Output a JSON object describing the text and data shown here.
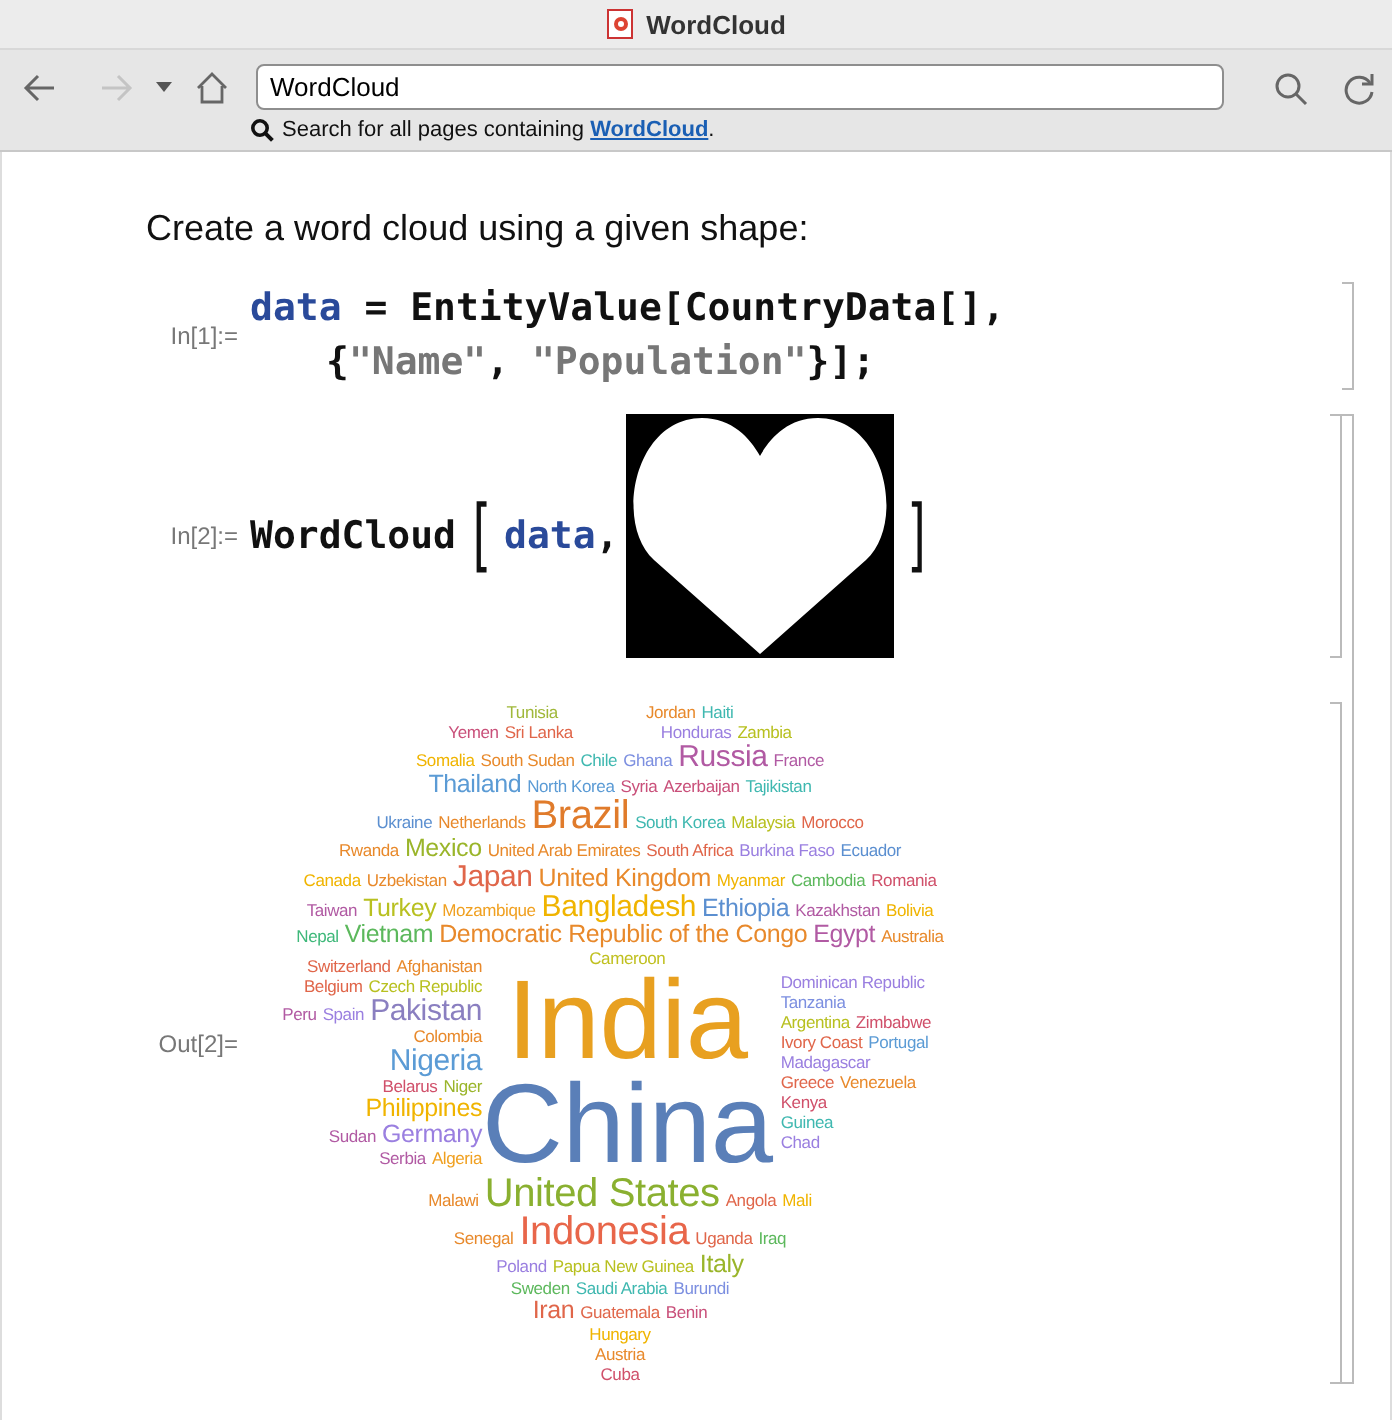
{
  "window": {
    "title": "WordCloud"
  },
  "toolbar": {
    "buttons": [
      {
        "kind": "back",
        "disabled": false
      },
      {
        "kind": "forward",
        "disabled": true
      },
      {
        "kind": "history",
        "disabled": false
      },
      {
        "kind": "home",
        "disabled": false
      }
    ],
    "address": "WordCloud",
    "actions": [
      {
        "kind": "search"
      },
      {
        "kind": "reload"
      }
    ],
    "hint": {
      "text": "Search for all pages containing ",
      "link": "WordCloud",
      "end": "."
    }
  },
  "notebook": {
    "heading": "Create a word cloud using a given shape:",
    "groups": [
      {
        "cells": [
          {
            "kind": "input",
            "label": "In[1]:=",
            "lines": [
              [
                {
                  "kind": "variable",
                  "text": "data"
                },
                {
                  "kind": "plain",
                  "text": " = EntityValue[CountryData[],"
                }
              ],
              [
                {
                  "kind": "plain",
                  "text": "{"
                },
                {
                  "kind": "string",
                  "text": "\"Name\""
                },
                {
                  "kind": "plain",
                  "text": ", "
                },
                {
                  "kind": "string",
                  "text": "\"Population\""
                },
                {
                  "kind": "plain",
                  "text": "}];"
                }
              ]
            ]
          }
        ]
      },
      {
        "cells": [
          {
            "kind": "input",
            "label": "In[2]:=",
            "lines": [
              [
                {
                  "kind": "plain",
                  "text": "WordCloud"
                },
                {
                  "kind": "bracket",
                  "text": "["
                },
                {
                  "kind": "variable",
                  "text": "data"
                },
                {
                  "kind": "plain",
                  "text": ","
                },
                {
                  "kind": "image"
                },
                {
                  "kind": "bracket",
                  "text": "]"
                }
              ]
            ]
          },
          {
            "kind": "output",
            "label": "Out[2]=",
            "cloud": {
              "top": [
                [
                  [
                    {
                      "text": "Tunisia",
                      "kind": "sm",
                      "color": "#a0b83a"
                    }
                  ],
                  [
                    {
                      "text": "Jordan",
                      "kind": "sm",
                      "color": "#e8892b"
                    },
                    {
                      "text": "Haiti",
                      "kind": "sm",
                      "color": "#3fb8b0"
                    }
                  ]
                ],
                [
                  [
                    {
                      "text": "Yemen",
                      "kind": "sm",
                      "color": "#c9507a"
                    },
                    {
                      "text": "Sri Lanka",
                      "kind": "sm",
                      "color": "#e0664a"
                    }
                  ],
                  [
                    {
                      "text": "Honduras",
                      "kind": "sm",
                      "color": "#9a7fe0"
                    },
                    {
                      "text": "Zambia",
                      "kind": "sm",
                      "color": "#b8c020"
                    }
                  ]
                ],
                [
                  [
                    {
                      "text": "Somalia",
                      "kind": "sm",
                      "color": "#f0b400"
                    },
                    {
                      "text": "South Sudan",
                      "kind": "sm",
                      "color": "#e8892b"
                    },
                    {
                      "text": "Chile",
                      "kind": "sm",
                      "color": "#3fb8b0"
                    },
                    {
                      "text": "Ghana",
                      "kind": "sm",
                      "color": "#7c8fe0"
                    },
                    {
                      "text": "Russia",
                      "kind": "ml",
                      "color": "#b15aa3"
                    },
                    {
                      "text": "France",
                      "kind": "sm",
                      "color": "#b15aa3"
                    }
                  ]
                ],
                [
                  [
                    {
                      "text": "Thailand",
                      "kind": "md",
                      "color": "#5b9bd5"
                    },
                    {
                      "text": "North Korea",
                      "kind": "sm",
                      "color": "#5b9bd5"
                    },
                    {
                      "text": "Syria",
                      "kind": "sm",
                      "color": "#c9507a"
                    },
                    {
                      "text": "Azerbaijan",
                      "kind": "sm",
                      "color": "#c9507a"
                    },
                    {
                      "text": "Tajikistan",
                      "kind": "sm",
                      "color": "#3fb8b0"
                    }
                  ]
                ],
                [
                  [
                    {
                      "text": "Ukraine",
                      "kind": "sm",
                      "color": "#5b8fd0"
                    },
                    {
                      "text": "Netherlands",
                      "kind": "sm",
                      "color": "#e8892b"
                    },
                    {
                      "text": "Brazil",
                      "kind": "lg",
                      "color": "#e07b2b"
                    },
                    {
                      "text": "South Korea",
                      "kind": "sm",
                      "color": "#3fb8b0"
                    },
                    {
                      "text": "Malaysia",
                      "kind": "sm",
                      "color": "#b8c020"
                    },
                    {
                      "text": "Morocco",
                      "kind": "sm",
                      "color": "#e0664a"
                    }
                  ]
                ],
                [
                  [
                    {
                      "text": "Rwanda",
                      "kind": "sm",
                      "color": "#e8892b"
                    },
                    {
                      "text": "Mexico",
                      "kind": "md",
                      "color": "#9ab52a"
                    },
                    {
                      "text": "United Arab Emirates",
                      "kind": "sm",
                      "color": "#e8892b"
                    },
                    {
                      "text": "South Africa",
                      "kind": "sm",
                      "color": "#e0664a"
                    },
                    {
                      "text": "Burkina Faso",
                      "kind": "sm",
                      "color": "#9a7fe0"
                    },
                    {
                      "text": "Ecuador",
                      "kind": "sm",
                      "color": "#5b8fd0"
                    }
                  ]
                ],
                [
                  [
                    {
                      "text": "Canada",
                      "kind": "sm",
                      "color": "#f0b400"
                    },
                    {
                      "text": "Uzbekistan",
                      "kind": "sm",
                      "color": "#e8892b"
                    },
                    {
                      "text": "Japan",
                      "kind": "ml",
                      "color": "#e0664a"
                    },
                    {
                      "text": "United Kingdom",
                      "kind": "md",
                      "color": "#e8892b"
                    },
                    {
                      "text": "Myanmar",
                      "kind": "sm",
                      "color": "#f0b400"
                    },
                    {
                      "text": "Cambodia",
                      "kind": "sm",
                      "color": "#5cb85c"
                    },
                    {
                      "text": "Romania",
                      "kind": "sm",
                      "color": "#d0506a"
                    }
                  ]
                ],
                [
                  [
                    {
                      "text": "Taiwan",
                      "kind": "sm",
                      "color": "#b15aa3"
                    },
                    {
                      "text": "Turkey",
                      "kind": "md",
                      "color": "#b8c020"
                    },
                    {
                      "text": "Mozambique",
                      "kind": "sm",
                      "color": "#f0a020"
                    },
                    {
                      "text": "Bangladesh",
                      "kind": "ml",
                      "color": "#f0b400"
                    },
                    {
                      "text": "Ethiopia",
                      "kind": "md",
                      "color": "#5b8fd0"
                    },
                    {
                      "text": "Kazakhstan",
                      "kind": "sm",
                      "color": "#b15aa3"
                    },
                    {
                      "text": "Bolivia",
                      "kind": "sm",
                      "color": "#f0b400"
                    }
                  ]
                ],
                [
                  [
                    {
                      "text": "Nepal",
                      "kind": "sm",
                      "color": "#3fb87a"
                    },
                    {
                      "text": "Vietnam",
                      "kind": "md",
                      "color": "#5cb85c"
                    },
                    {
                      "text": "Democratic Republic of the Congo",
                      "kind": "md",
                      "color": "#e8892b"
                    },
                    {
                      "text": "Egypt",
                      "kind": "md",
                      "color": "#b15aa3"
                    },
                    {
                      "text": "Australia",
                      "kind": "sm",
                      "color": "#e8892b"
                    }
                  ]
                ]
              ],
              "left": [
                [
                  [
                    {
                      "text": "Switzerland",
                      "kind": "sm",
                      "color": "#e0664a"
                    },
                    {
                      "text": "Afghanistan",
                      "kind": "sm",
                      "color": "#e8892b"
                    }
                  ]
                ],
                [
                  [
                    {
                      "text": "Belgium",
                      "kind": "sm",
                      "color": "#e0664a"
                    },
                    {
                      "text": "Czech Republic",
                      "kind": "sm",
                      "color": "#b8c020"
                    }
                  ]
                ],
                [
                  [
                    {
                      "text": "Peru",
                      "kind": "sm",
                      "color": "#b15aa3"
                    },
                    {
                      "text": "Spain",
                      "kind": "sm",
                      "color": "#9a7fe0"
                    },
                    {
                      "text": "Pakistan",
                      "kind": "ml",
                      "color": "#8a7fc0"
                    }
                  ]
                ],
                [
                  [
                    {
                      "text": "Colombia",
                      "kind": "sm",
                      "color": "#e8892b"
                    }
                  ]
                ],
                [
                  [
                    {
                      "text": "Nigeria",
                      "kind": "ml",
                      "color": "#5b9bd5"
                    }
                  ]
                ],
                [
                  [
                    {
                      "text": "Belarus",
                      "kind": "sm",
                      "color": "#d0506a"
                    },
                    {
                      "text": "Niger",
                      "kind": "sm",
                      "color": "#9ab52a"
                    }
                  ]
                ],
                [
                  [
                    {
                      "text": "Philippines",
                      "kind": "md",
                      "color": "#f0b400"
                    }
                  ]
                ],
                [
                  [
                    {
                      "text": "Sudan",
                      "kind": "sm",
                      "color": "#b15aa3"
                    },
                    {
                      "text": "Germany",
                      "kind": "md",
                      "color": "#9a7fe0"
                    }
                  ]
                ],
                [
                  [
                    {
                      "text": "Serbia",
                      "kind": "sm",
                      "color": "#b15aa3"
                    },
                    {
                      "text": "Algeria",
                      "kind": "sm",
                      "color": "#f0a020"
                    }
                  ]
                ]
              ],
              "center": [
                [
                  [
                    {
                      "text": "Cameroon",
                      "kind": "sm",
                      "color": "#c0c020"
                    }
                  ]
                ],
                [
                  [
                    {
                      "text": "India",
                      "kind": "xl",
                      "color": "#e8a020"
                    }
                  ]
                ],
                [
                  [
                    {
                      "text": "China",
                      "kind": "xl",
                      "color": "#5a7fb8"
                    }
                  ]
                ]
              ],
              "right": [
                [
                  [
                    {
                      "text": "Dominican Republic",
                      "kind": "sm",
                      "color": "#9a7fe0"
                    }
                  ]
                ],
                [
                  [
                    {
                      "text": "Tanzania",
                      "kind": "sm",
                      "color": "#7c8fe0"
                    }
                  ]
                ],
                [
                  [
                    {
                      "text": "Argentina",
                      "kind": "sm",
                      "color": "#b8c020"
                    },
                    {
                      "text": "Zimbabwe",
                      "kind": "sm",
                      "color": "#d0506a"
                    }
                  ]
                ],
                [
                  [
                    {
                      "text": "Ivory Coast",
                      "kind": "sm",
                      "color": "#e0664a"
                    },
                    {
                      "text": "Portugal",
                      "kind": "sm",
                      "color": "#5b9bd5"
                    }
                  ]
                ],
                [
                  [
                    {
                      "text": "Madagascar",
                      "kind": "sm",
                      "color": "#9a7fe0"
                    }
                  ]
                ],
                [
                  [
                    {
                      "text": "Greece",
                      "kind": "sm",
                      "color": "#e0664a"
                    },
                    {
                      "text": "Venezuela",
                      "kind": "sm",
                      "color": "#e8892b"
                    }
                  ]
                ],
                [
                  [
                    {
                      "text": "Kenya",
                      "kind": "sm",
                      "color": "#d0506a"
                    }
                  ]
                ],
                [
                  [
                    {
                      "text": "Guinea",
                      "kind": "sm",
                      "color": "#3fb8b0"
                    }
                  ]
                ],
                [
                  [
                    {
                      "text": "Chad",
                      "kind": "sm",
                      "color": "#9a7fe0"
                    }
                  ]
                ]
              ],
              "bottom": [
                [
                  [
                    {
                      "text": "Malawi",
                      "kind": "sm",
                      "color": "#e8892b"
                    },
                    {
                      "text": "United States",
                      "kind": "lg",
                      "color": "#8ab030"
                    },
                    {
                      "text": "Angola",
                      "kind": "sm",
                      "color": "#e0664a"
                    },
                    {
                      "text": "Mali",
                      "kind": "sm",
                      "color": "#f0b400"
                    }
                  ]
                ],
                [
                  [
                    {
                      "text": "Senegal",
                      "kind": "sm",
                      "color": "#e8892b"
                    },
                    {
                      "text": "Indonesia",
                      "kind": "lg",
                      "color": "#e8664a"
                    },
                    {
                      "text": "Uganda",
                      "kind": "sm",
                      "color": "#e0664a"
                    },
                    {
                      "text": "Iraq",
                      "kind": "sm",
                      "color": "#5cb85c"
                    }
                  ]
                ],
                [
                  [
                    {
                      "text": "Poland",
                      "kind": "sm",
                      "color": "#9a7fe0"
                    },
                    {
                      "text": "Papua New Guinea",
                      "kind": "sm",
                      "color": "#b8c020"
                    },
                    {
                      "text": "Italy",
                      "kind": "md",
                      "color": "#9ab52a"
                    }
                  ]
                ],
                [
                  [
                    {
                      "text": "Sweden",
                      "kind": "sm",
                      "color": "#5cb85c"
                    },
                    {
                      "text": "Saudi Arabia",
                      "kind": "sm",
                      "color": "#3fb8b0"
                    },
                    {
                      "text": "Burundi",
                      "kind": "sm",
                      "color": "#7c8fe0"
                    }
                  ]
                ],
                [
                  [
                    {
                      "text": "Iran",
                      "kind": "md",
                      "color": "#e0664a"
                    },
                    {
                      "text": "Guatemala",
                      "kind": "sm",
                      "color": "#e0664a"
                    },
                    {
                      "text": "Benin",
                      "kind": "sm",
                      "color": "#c9507a"
                    }
                  ]
                ],
                [
                  [
                    {
                      "text": "Hungary",
                      "kind": "sm",
                      "color": "#f0b400"
                    }
                  ]
                ],
                [
                  [
                    {
                      "text": "Austria",
                      "kind": "sm",
                      "color": "#e8892b"
                    }
                  ]
                ],
                [
                  [
                    {
                      "text": "Cuba",
                      "kind": "sm",
                      "color": "#d0506a"
                    }
                  ]
                ]
              ]
            }
          }
        ]
      }
    ]
  }
}
